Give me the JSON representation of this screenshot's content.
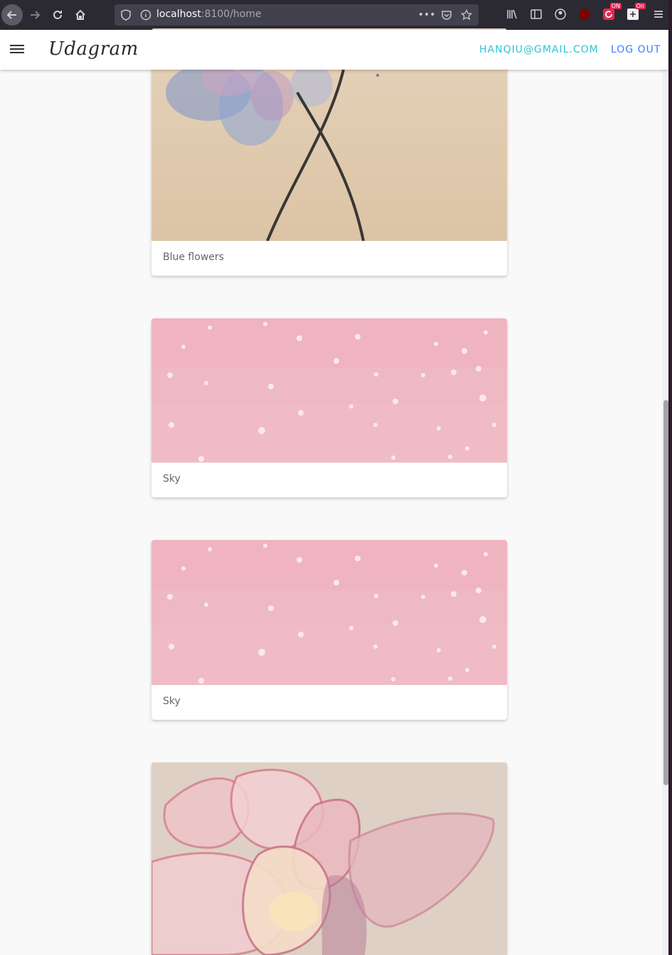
{
  "browser": {
    "url_host": "localhost",
    "url_rest": ":8100/home",
    "more_label": "•••",
    "ext_badge_1": "ON",
    "ext_badge_2": "On"
  },
  "header": {
    "brand": "Udagram",
    "user_email": "HANQIU@GMAIL.COM",
    "logout_label": "LOG OUT"
  },
  "feed": [
    {
      "caption": "Blue flowers",
      "image": "blue-flowers-watercolor"
    },
    {
      "caption": "Sky",
      "image": "pink-sky-watercolor"
    },
    {
      "caption": "Sky",
      "image": "pink-sky-watercolor"
    },
    {
      "caption": "",
      "image": "pink-lotus-watercolor"
    }
  ],
  "colors": {
    "accent_email": "#2ec4d6",
    "accent_logout": "#3880ff",
    "page_bg": "#f9f9f9"
  }
}
